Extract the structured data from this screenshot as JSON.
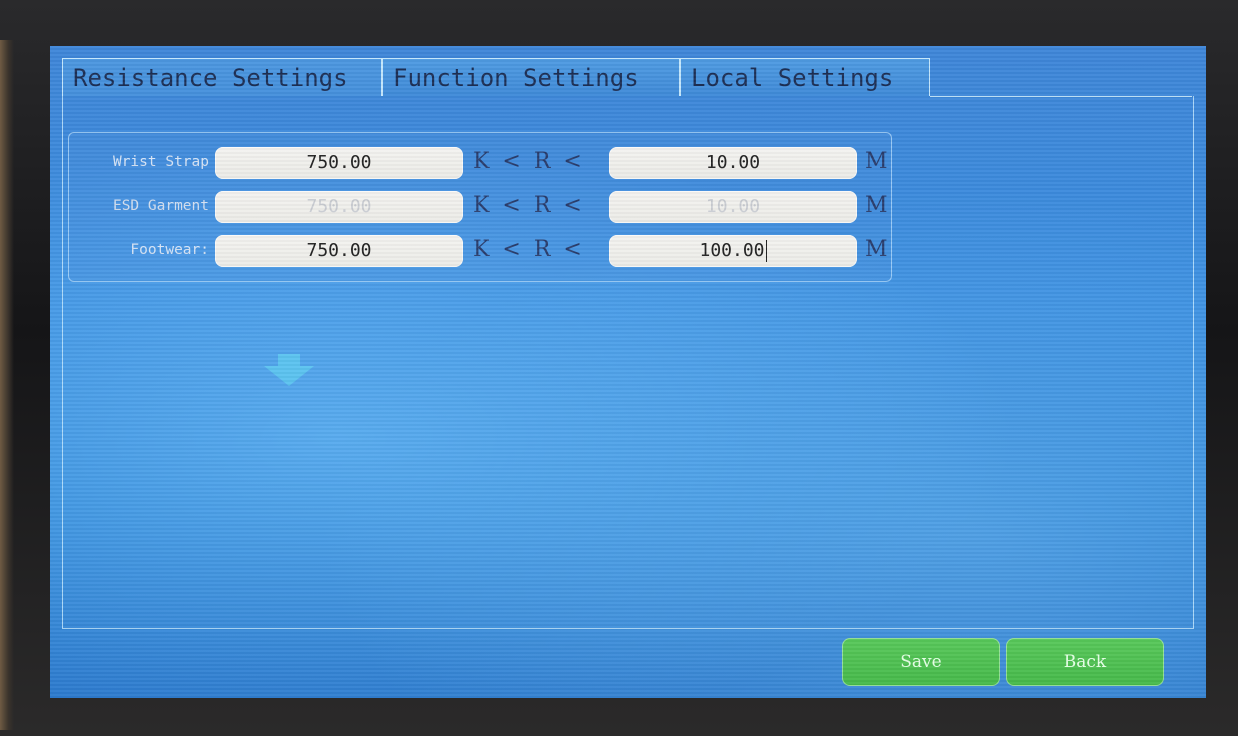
{
  "tabs": [
    {
      "label": "Resistance Settings"
    },
    {
      "label": "Function Settings"
    },
    {
      "label": "Local Settings"
    }
  ],
  "rows": [
    {
      "label": "Wrist Strap",
      "min_value": "750.00",
      "relation": "K < R <",
      "max_value": "10.00",
      "unit": "M",
      "enabled": true
    },
    {
      "label": "ESD Garment",
      "min_value": "750.00",
      "relation": "K < R <",
      "max_value": "10.00",
      "unit": "M",
      "enabled": false
    },
    {
      "label": "Footwear:",
      "min_value": "750.00",
      "relation": "K < R <",
      "max_value": "100.00",
      "unit": "M",
      "enabled": true
    }
  ],
  "icons": {
    "arrow": "arrow-down-icon"
  },
  "buttons": {
    "save_label": "Save",
    "back_label": "Back"
  },
  "colors": {
    "screen_bg": "#3a8ee0",
    "button_green": "#4cbf4f",
    "arrow": "#5cc3ef"
  }
}
